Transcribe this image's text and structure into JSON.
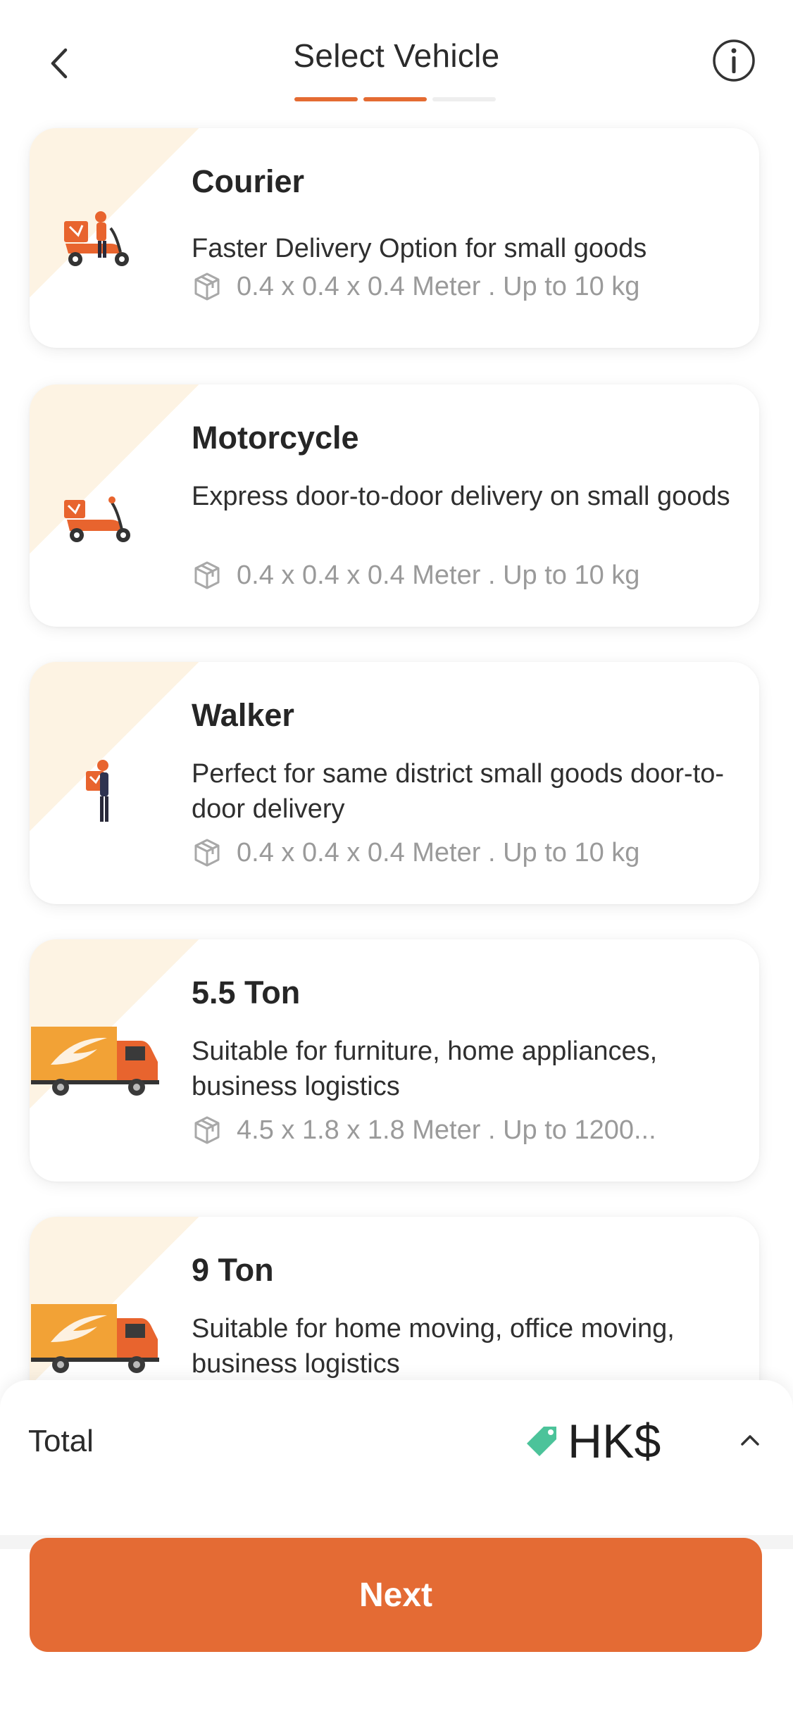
{
  "header": {
    "title": "Select Vehicle",
    "progress": {
      "total_steps": 3,
      "completed_steps": 2
    }
  },
  "vehicles": [
    {
      "name": "Courier",
      "description": "Faster Delivery Option for small goods",
      "spec": "0.4 x 0.4 x 0.4 Meter . Up to 10 kg",
      "icon": "courier-scooter-icon"
    },
    {
      "name": "Motorcycle",
      "description": "Express door-to-door delivery on small goods",
      "spec": "0.4 x 0.4 x 0.4 Meter . Up to 10 kg",
      "icon": "motorcycle-icon"
    },
    {
      "name": "Walker",
      "description": "Perfect for same district small goods door-to-door delivery",
      "spec": "0.4 x 0.4 x 0.4 Meter . Up to 10 kg",
      "icon": "walker-icon"
    },
    {
      "name": "5.5 Ton",
      "description": "Suitable for furniture, home appliances, business logistics",
      "spec": "4.5 x 1.8 x 1.8 Meter . Up to 1200...",
      "icon": "truck-icon"
    },
    {
      "name": "9 Ton",
      "description": "Suitable for home moving, office moving, business logistics",
      "icon": "truck-icon"
    }
  ],
  "summary": {
    "total_label": "Total",
    "currency": "HK$",
    "next_label": "Next"
  },
  "colors": {
    "accent": "#e46b34",
    "tag": "#4cc39a",
    "card_wedge": "#fdf3e3"
  }
}
